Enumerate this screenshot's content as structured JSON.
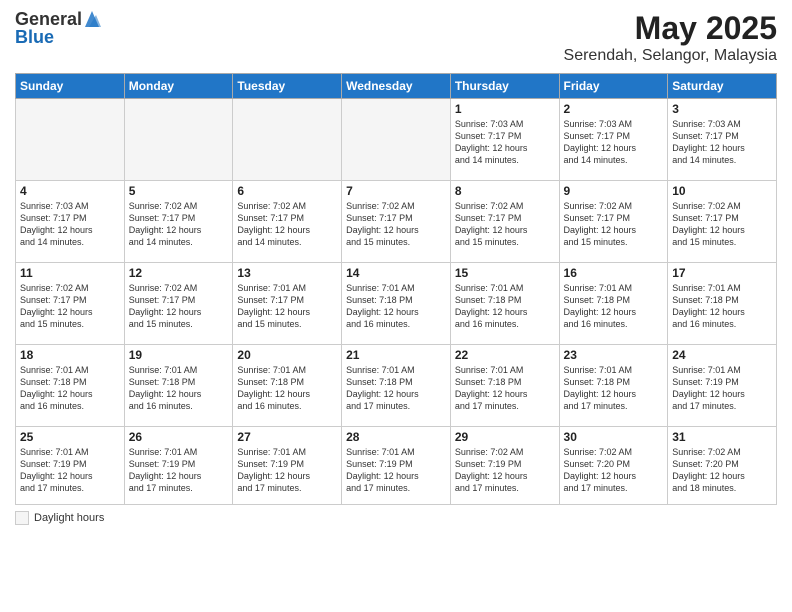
{
  "header": {
    "logo_general": "General",
    "logo_blue": "Blue",
    "title": "May 2025",
    "subtitle": "Serendah, Selangor, Malaysia"
  },
  "weekdays": [
    "Sunday",
    "Monday",
    "Tuesday",
    "Wednesday",
    "Thursday",
    "Friday",
    "Saturday"
  ],
  "legend": {
    "label": "Daylight hours"
  },
  "weeks": [
    [
      {
        "day": "",
        "info": ""
      },
      {
        "day": "",
        "info": ""
      },
      {
        "day": "",
        "info": ""
      },
      {
        "day": "",
        "info": ""
      },
      {
        "day": "1",
        "info": "Sunrise: 7:03 AM\nSunset: 7:17 PM\nDaylight: 12 hours\nand 14 minutes."
      },
      {
        "day": "2",
        "info": "Sunrise: 7:03 AM\nSunset: 7:17 PM\nDaylight: 12 hours\nand 14 minutes."
      },
      {
        "day": "3",
        "info": "Sunrise: 7:03 AM\nSunset: 7:17 PM\nDaylight: 12 hours\nand 14 minutes."
      }
    ],
    [
      {
        "day": "4",
        "info": "Sunrise: 7:03 AM\nSunset: 7:17 PM\nDaylight: 12 hours\nand 14 minutes."
      },
      {
        "day": "5",
        "info": "Sunrise: 7:02 AM\nSunset: 7:17 PM\nDaylight: 12 hours\nand 14 minutes."
      },
      {
        "day": "6",
        "info": "Sunrise: 7:02 AM\nSunset: 7:17 PM\nDaylight: 12 hours\nand 14 minutes."
      },
      {
        "day": "7",
        "info": "Sunrise: 7:02 AM\nSunset: 7:17 PM\nDaylight: 12 hours\nand 15 minutes."
      },
      {
        "day": "8",
        "info": "Sunrise: 7:02 AM\nSunset: 7:17 PM\nDaylight: 12 hours\nand 15 minutes."
      },
      {
        "day": "9",
        "info": "Sunrise: 7:02 AM\nSunset: 7:17 PM\nDaylight: 12 hours\nand 15 minutes."
      },
      {
        "day": "10",
        "info": "Sunrise: 7:02 AM\nSunset: 7:17 PM\nDaylight: 12 hours\nand 15 minutes."
      }
    ],
    [
      {
        "day": "11",
        "info": "Sunrise: 7:02 AM\nSunset: 7:17 PM\nDaylight: 12 hours\nand 15 minutes."
      },
      {
        "day": "12",
        "info": "Sunrise: 7:02 AM\nSunset: 7:17 PM\nDaylight: 12 hours\nand 15 minutes."
      },
      {
        "day": "13",
        "info": "Sunrise: 7:01 AM\nSunset: 7:17 PM\nDaylight: 12 hours\nand 15 minutes."
      },
      {
        "day": "14",
        "info": "Sunrise: 7:01 AM\nSunset: 7:18 PM\nDaylight: 12 hours\nand 16 minutes."
      },
      {
        "day": "15",
        "info": "Sunrise: 7:01 AM\nSunset: 7:18 PM\nDaylight: 12 hours\nand 16 minutes."
      },
      {
        "day": "16",
        "info": "Sunrise: 7:01 AM\nSunset: 7:18 PM\nDaylight: 12 hours\nand 16 minutes."
      },
      {
        "day": "17",
        "info": "Sunrise: 7:01 AM\nSunset: 7:18 PM\nDaylight: 12 hours\nand 16 minutes."
      }
    ],
    [
      {
        "day": "18",
        "info": "Sunrise: 7:01 AM\nSunset: 7:18 PM\nDaylight: 12 hours\nand 16 minutes."
      },
      {
        "day": "19",
        "info": "Sunrise: 7:01 AM\nSunset: 7:18 PM\nDaylight: 12 hours\nand 16 minutes."
      },
      {
        "day": "20",
        "info": "Sunrise: 7:01 AM\nSunset: 7:18 PM\nDaylight: 12 hours\nand 16 minutes."
      },
      {
        "day": "21",
        "info": "Sunrise: 7:01 AM\nSunset: 7:18 PM\nDaylight: 12 hours\nand 17 minutes."
      },
      {
        "day": "22",
        "info": "Sunrise: 7:01 AM\nSunset: 7:18 PM\nDaylight: 12 hours\nand 17 minutes."
      },
      {
        "day": "23",
        "info": "Sunrise: 7:01 AM\nSunset: 7:18 PM\nDaylight: 12 hours\nand 17 minutes."
      },
      {
        "day": "24",
        "info": "Sunrise: 7:01 AM\nSunset: 7:19 PM\nDaylight: 12 hours\nand 17 minutes."
      }
    ],
    [
      {
        "day": "25",
        "info": "Sunrise: 7:01 AM\nSunset: 7:19 PM\nDaylight: 12 hours\nand 17 minutes."
      },
      {
        "day": "26",
        "info": "Sunrise: 7:01 AM\nSunset: 7:19 PM\nDaylight: 12 hours\nand 17 minutes."
      },
      {
        "day": "27",
        "info": "Sunrise: 7:01 AM\nSunset: 7:19 PM\nDaylight: 12 hours\nand 17 minutes."
      },
      {
        "day": "28",
        "info": "Sunrise: 7:01 AM\nSunset: 7:19 PM\nDaylight: 12 hours\nand 17 minutes."
      },
      {
        "day": "29",
        "info": "Sunrise: 7:02 AM\nSunset: 7:19 PM\nDaylight: 12 hours\nand 17 minutes."
      },
      {
        "day": "30",
        "info": "Sunrise: 7:02 AM\nSunset: 7:20 PM\nDaylight: 12 hours\nand 17 minutes."
      },
      {
        "day": "31",
        "info": "Sunrise: 7:02 AM\nSunset: 7:20 PM\nDaylight: 12 hours\nand 18 minutes."
      }
    ]
  ]
}
